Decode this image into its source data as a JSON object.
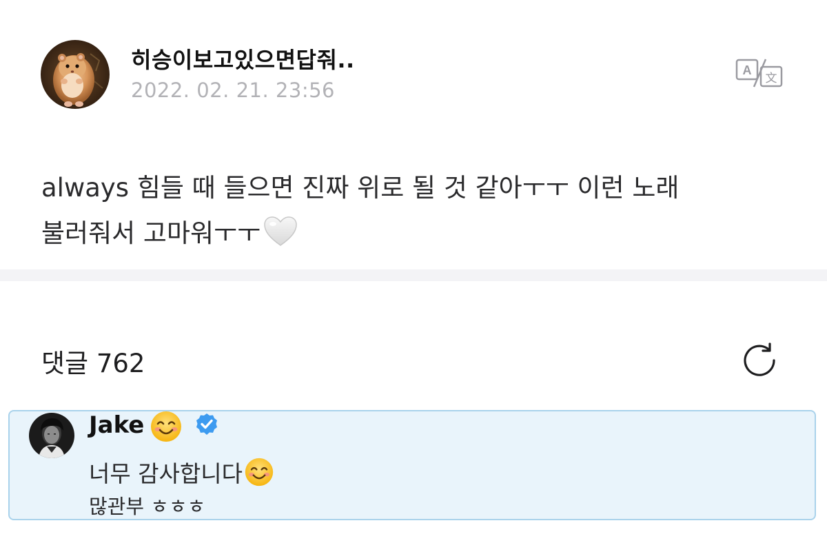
{
  "post": {
    "author_name": "히승이보고있으면답줘..",
    "date": "2022. 02. 21. 23:56",
    "body_line1": "always 힘들 때 들으면 진짜 위로 될 것 같아ㅜㅜ 이런 노래",
    "body_line2": "불러줘서 고마워ㅜㅜ",
    "body_emoji": "white-heart-icon",
    "translate_icon": "translate-icon"
  },
  "comments": {
    "label": "댓글 762",
    "refresh_icon": "refresh-icon"
  },
  "featured_comment": {
    "author": "Jake",
    "author_emoji": "smiling-face-icon",
    "verified": true,
    "verified_color": "#3d9bf0",
    "line1": "너무 감사합니다",
    "line1_emoji": "smiling-face-icon",
    "line2": "많관부 ㅎㅎㅎ",
    "highlight_bg": "#e9f4fb",
    "highlight_border": "#a9d2eb"
  },
  "colors": {
    "date_gray": "#b2b2b6",
    "divider": "#f3f3f6"
  }
}
